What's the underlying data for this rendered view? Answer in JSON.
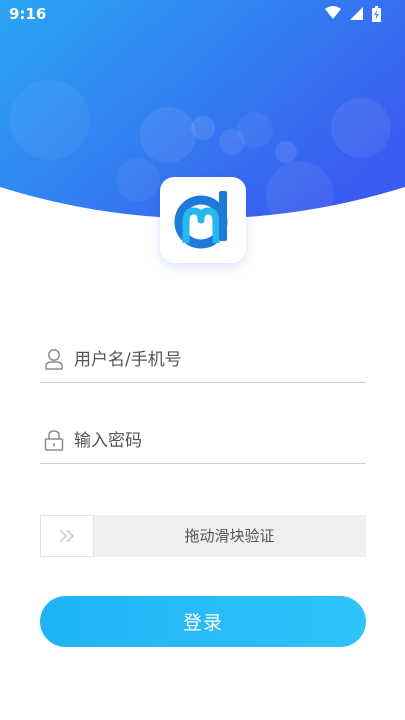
{
  "status_bar": {
    "time": "9:16",
    "icons": [
      "wifi-icon",
      "cellular-signal-icon",
      "battery-charging-icon"
    ]
  },
  "colors": {
    "header_gradient_start": "#2aa0f2",
    "header_gradient_end": "#3a5ef0",
    "accent": "#25b8f8",
    "logo_blue": "#1e7ad8",
    "logo_cyan": "#25b8f0"
  },
  "login_form": {
    "username": {
      "placeholder": "用户名/手机号",
      "value": "",
      "icon": "user-icon"
    },
    "password": {
      "placeholder": "输入密码",
      "value": "",
      "icon": "lock-icon"
    },
    "slider_verify": {
      "label": "拖动滑块验证",
      "icon": "double-chevron-right-icon"
    },
    "submit_label": "登录"
  }
}
